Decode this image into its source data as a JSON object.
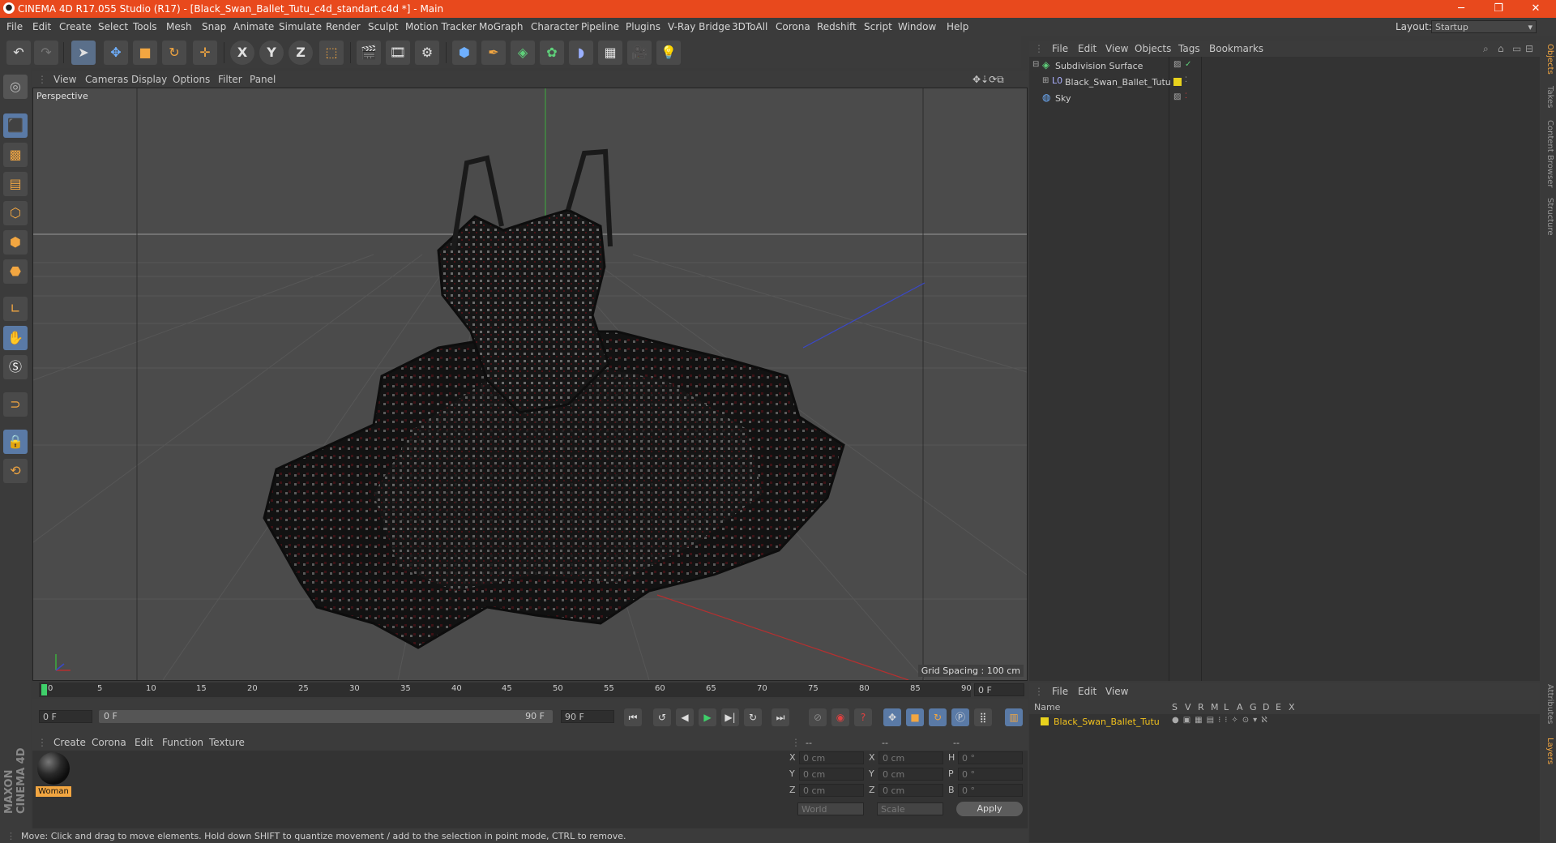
{
  "window": {
    "title": "CINEMA 4D R17.055 Studio (R17) - [Black_Swan_Ballet_Tutu_c4d_standart.c4d *] - Main",
    "controls": [
      "─",
      "❐",
      "✕"
    ]
  },
  "menubar": {
    "items": [
      "File",
      "Edit",
      "Create",
      "Select",
      "Tools",
      "Mesh",
      "Snap",
      "Animate",
      "Simulate",
      "Render",
      "Sculpt",
      "Motion Tracker",
      "MoGraph",
      "Character",
      "Pipeline",
      "Plugins",
      "V-Ray Bridge",
      "3DToAll",
      "Corona",
      "Redshift",
      "Script",
      "Window",
      "Help"
    ],
    "layout_label": "Layout:",
    "layout_value": "Startup"
  },
  "toolbar": {
    "icons": [
      "undo-icon",
      "redo-icon",
      "select-pointer-icon",
      "move-icon",
      "scale-icon",
      "rotate-icon",
      "transform-icon",
      "x-axis-icon",
      "y-axis-icon",
      "z-axis-icon",
      "coordinate-system-icon",
      "render-view-icon",
      "render-picture-viewer-icon",
      "render-settings-icon",
      "cube-primitive-icon",
      "spline-pen-icon",
      "subdivision-icon",
      "array-icon",
      "deformer-icon",
      "floor-icon",
      "camera-icon",
      "light-icon"
    ],
    "axis_labels": [
      "X",
      "Y",
      "Z"
    ]
  },
  "viewport": {
    "menu": [
      "View",
      "Cameras",
      "Display",
      "Options",
      "Filter",
      "Panel"
    ],
    "camera_label": "Perspective",
    "grid_spacing": "Grid Spacing : 100 cm"
  },
  "timeline": {
    "ticks": [
      "0",
      "5",
      "10",
      "15",
      "20",
      "25",
      "30",
      "35",
      "40",
      "45",
      "50",
      "55",
      "60",
      "65",
      "70",
      "75",
      "80",
      "85",
      "90"
    ],
    "current_frame_field": "0 F",
    "start_field": "0 F",
    "range_start": "0 F",
    "range_end": "90 F",
    "end_field": "90 F"
  },
  "materials": {
    "menu": [
      "Create",
      "Corona",
      "Edit",
      "Function",
      "Texture"
    ],
    "items": [
      {
        "name": "Woman"
      }
    ]
  },
  "coordinates": {
    "header": [
      "--",
      "--",
      "--"
    ],
    "rows": [
      {
        "a": "X",
        "av": "0 cm",
        "b": "X",
        "bv": "0 cm",
        "c": "H",
        "cv": "0 °"
      },
      {
        "a": "Y",
        "av": "0 cm",
        "b": "Y",
        "bv": "0 cm",
        "c": "P",
        "cv": "0 °"
      },
      {
        "a": "Z",
        "av": "0 cm",
        "b": "Z",
        "bv": "0 cm",
        "c": "B",
        "cv": "0 °"
      }
    ],
    "mode1": "World",
    "mode2": "Scale",
    "apply": "Apply"
  },
  "objects": {
    "menu": [
      "File",
      "Edit",
      "View",
      "Objects",
      "Tags",
      "Bookmarks"
    ],
    "items": [
      "Subdivision Surface",
      "Black_Swan_Ballet_Tutu",
      "Sky"
    ]
  },
  "layers": {
    "menu": [
      "File",
      "Edit",
      "View"
    ],
    "columns": [
      "Name",
      "S",
      "V",
      "R",
      "M",
      "L",
      "A",
      "G",
      "D",
      "E",
      "X"
    ],
    "items": [
      "Black_Swan_Ballet_Tutu"
    ],
    "layer_color": "#e8d21d"
  },
  "right_tabs": [
    "Objects",
    "Takes",
    "Content Browser",
    "Structure",
    "Attributes",
    "Layers"
  ],
  "status": "Move: Click and drag to move elements. Hold down SHIFT to quantize movement / add to the selection in point mode, CTRL to remove.",
  "branding": "MAXON CINEMA 4D",
  "colors": {
    "title_bar": "#e8491d",
    "accent_orange": "#f2a641",
    "selection_blue": "#5a7aa6"
  }
}
